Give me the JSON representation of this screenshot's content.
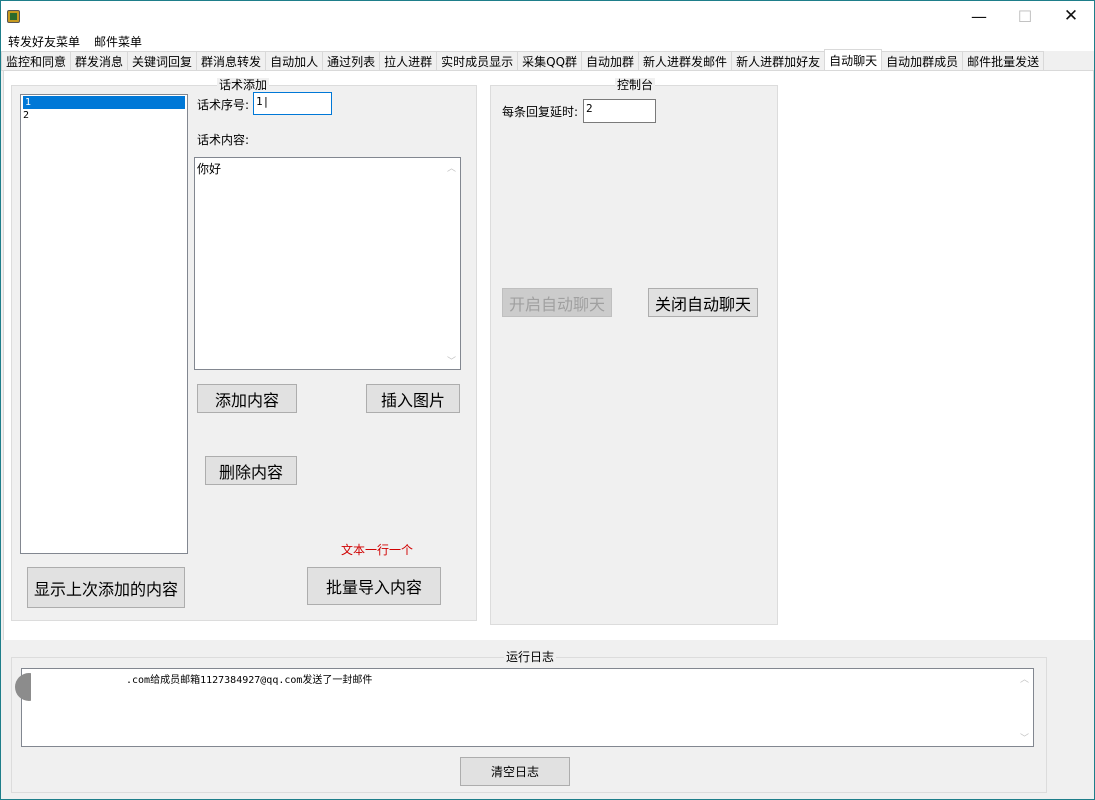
{
  "window": {
    "minimize_glyph": "—",
    "maximize_glyph": "☐",
    "close_glyph": "✕"
  },
  "menu": {
    "items": [
      "转发好友菜单",
      "邮件菜单"
    ]
  },
  "tabs": [
    "监控和同意",
    "群发消息",
    "关键词回复",
    "群消息转发",
    "自动加人",
    "通过列表",
    "拉人进群",
    "实时成员显示",
    "采集QQ群",
    "自动加群",
    "新人进群发邮件",
    "新人进群加好友",
    "自动聊天",
    "自动加群成员",
    "邮件批量发送"
  ],
  "active_tab": "自动聊天",
  "script_group": {
    "title": "话术添加",
    "list_items": [
      "1",
      "2"
    ],
    "selected_index": 0,
    "seq_label": "话术序号:",
    "seq_value": "1|",
    "content_label": "话术内容:",
    "content_value": "你好",
    "add_button": "添加内容",
    "insert_image_button": "插入图片",
    "delete_button": "删除内容",
    "hint_text": "文本一行一个",
    "hint_color": "#d00000",
    "show_last_button": "显示上次添加的内容",
    "batch_import_button": "批量导入内容"
  },
  "console_group": {
    "title": "控制台",
    "delay_label": "每条回复延时:",
    "delay_value": "2",
    "start_button": "开启自动聊天",
    "start_enabled": false,
    "stop_button": "关闭自动聊天"
  },
  "log": {
    "title": "运行日志",
    "line_visible": ".com给成员邮箱1127384927@qq.com发送了一封邮件",
    "clear_button": "清空日志"
  },
  "colors": {
    "accent": "#0078d7",
    "window_border": "#1e7e8a"
  }
}
